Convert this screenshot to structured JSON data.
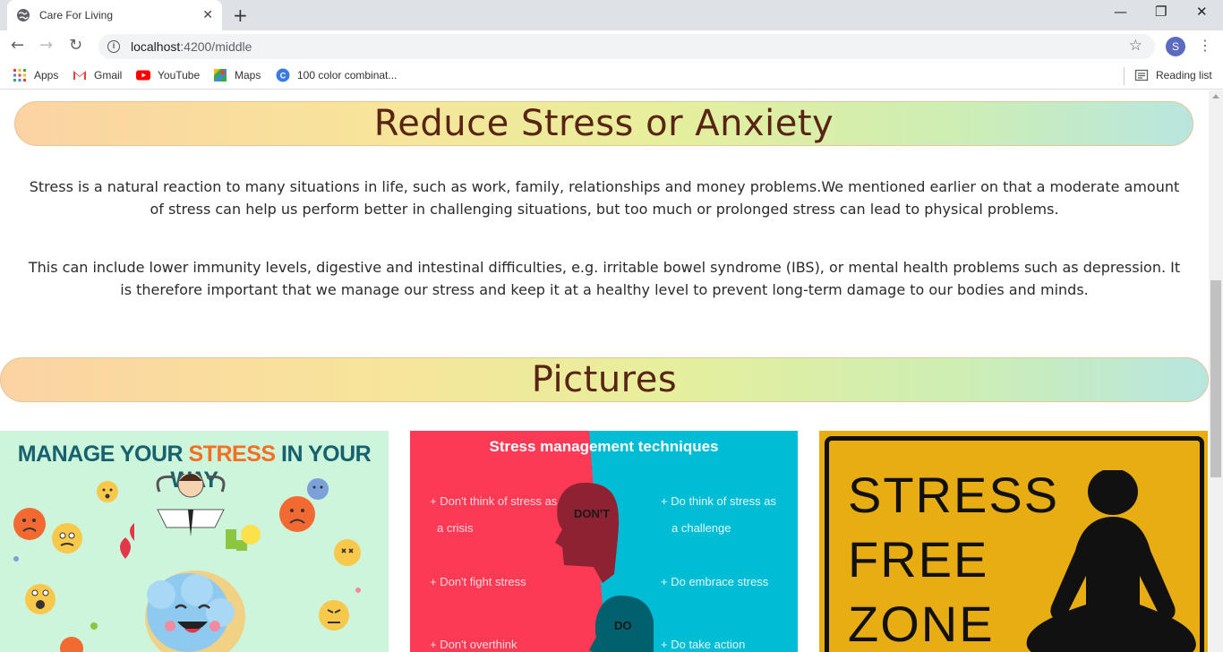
{
  "browser": {
    "tab_title": "Care For Living",
    "url_host": "localhost",
    "url_path": ":4200/middle",
    "avatar_letter": "S",
    "bookmarks": [
      "Apps",
      "Gmail",
      "YouTube",
      "Maps",
      "100 color combinat..."
    ],
    "reading_list": "Reading list"
  },
  "section_stress": {
    "title": "Reduce Stress or Anxiety",
    "paragraph_1": "Stress is a natural reaction to many situations in life, such as work, family, relationships and money problems.We mentioned earlier on that a moderate amount of stress can help us perform better in challenging situations, but too much or prolonged stress can lead to physical problems.",
    "paragraph_2": "This can include lower immunity levels, digestive and intestinal difficulties, e.g. irritable bowel syndrome (IBS), or mental health problems such as depression. It is therefore important that we manage our stress and keep it at a healthy level to prevent long-term damage to our bodies and minds."
  },
  "section_pictures": {
    "title": "Pictures",
    "card1": {
      "heading_part1": "MANAGE YOUR ",
      "heading_highlight": "STRESS",
      "heading_part2": " IN YOUR WAY"
    },
    "card2": {
      "heading": "Stress management techniques",
      "dont_label": "DON'T",
      "do_label": "DO",
      "dont_items": [
        "Don't think of stress as",
        "a crisis",
        "Don't fight stress",
        "Don't overthink"
      ],
      "do_items": [
        "Do think of stress as",
        "a challenge",
        "Do embrace stress",
        "Do take action"
      ]
    },
    "card3": {
      "line1": "STRESS",
      "line2": "FREE",
      "line3": "ZONE"
    }
  },
  "colors": {
    "heading_brown": "#5a2414",
    "card2_red": "#fd3a55",
    "card2_cyan": "#00bcd4",
    "card3_yellow": "#e8ad12"
  }
}
